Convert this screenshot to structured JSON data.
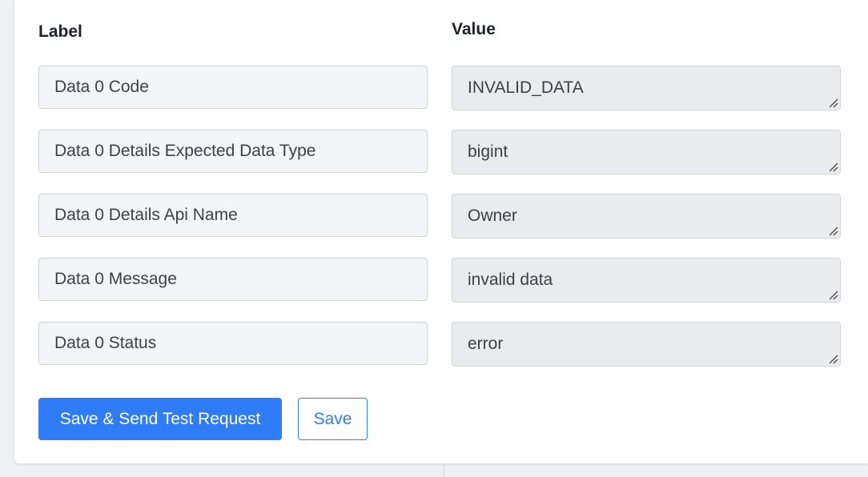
{
  "headers": {
    "label": "Label",
    "value": "Value"
  },
  "rows": [
    {
      "label": "Data 0 Code",
      "value": "INVALID_DATA"
    },
    {
      "label": "Data 0 Details Expected Data Type",
      "value": "bigint"
    },
    {
      "label": "Data 0 Details Api Name",
      "value": "Owner"
    },
    {
      "label": "Data 0 Message",
      "value": "invalid data"
    },
    {
      "label": "Data 0 Status",
      "value": "error"
    }
  ],
  "actions": {
    "save_and_send_label": "Save & Send Test Request",
    "save_label": "Save"
  },
  "colors": {
    "primary": "#2f7cf6",
    "label_field_bg": "#f3f6f9",
    "value_field_bg": "#e9ebee",
    "border": "#cfd4da"
  }
}
